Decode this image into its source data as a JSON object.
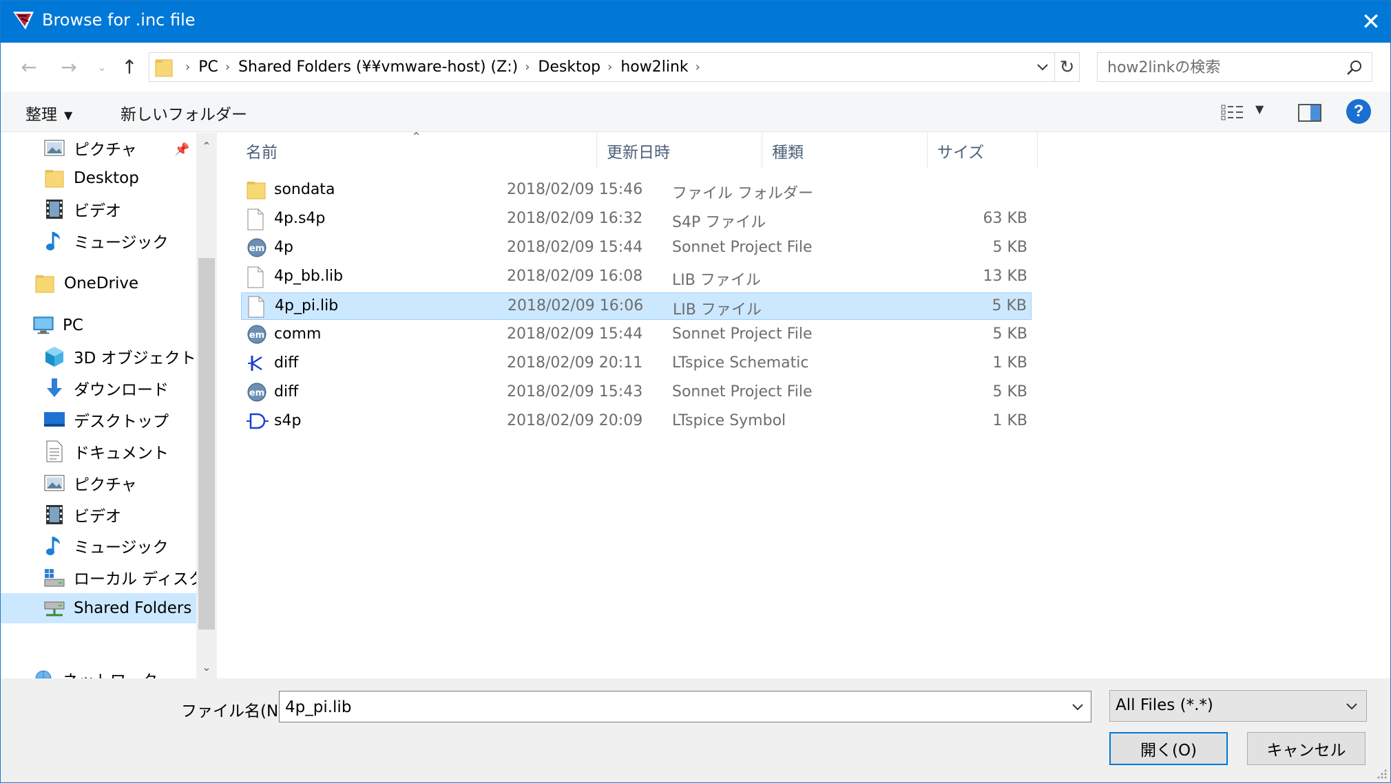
{
  "window": {
    "title": "Browse for .inc file",
    "close_label": "✕"
  },
  "address": {
    "crumbs": [
      "PC",
      "Shared Folders (¥¥vmware-host) (Z:)",
      "Desktop",
      "how2link"
    ],
    "search_placeholder": "how2linkの検索"
  },
  "toolbar": {
    "organize_label": "整理",
    "new_folder_label": "新しいフォルダー",
    "help_label": "?"
  },
  "nav": {
    "items": [
      {
        "label": "ピクチャ",
        "icon": "pictures-icon"
      },
      {
        "label": "Desktop",
        "icon": "folder-icon"
      },
      {
        "label": "ビデオ",
        "icon": "videos-icon"
      },
      {
        "label": "ミュージック",
        "icon": "music-icon"
      },
      {
        "label": "OneDrive",
        "icon": "folder-icon"
      },
      {
        "label": "PC",
        "icon": "computer-icon"
      },
      {
        "label": "3D オブジェクト",
        "icon": "3d-objects-icon"
      },
      {
        "label": "ダウンロード",
        "icon": "downloads-icon"
      },
      {
        "label": "デスクトップ",
        "icon": "desktop-icon"
      },
      {
        "label": "ドキュメント",
        "icon": "documents-icon"
      },
      {
        "label": "ピクチャ",
        "icon": "pictures-icon"
      },
      {
        "label": "ビデオ",
        "icon": "videos-icon"
      },
      {
        "label": "ミュージック",
        "icon": "music-icon"
      },
      {
        "label": "ローカル ディスク (C",
        "icon": "local-disk-icon"
      },
      {
        "label": "Shared Folders (¥",
        "icon": "network-drive-icon"
      },
      {
        "label": "ネットワーク",
        "icon": "network-icon"
      }
    ]
  },
  "columns": {
    "name": "名前",
    "date": "更新日時",
    "type": "種類",
    "size": "サイズ"
  },
  "files": [
    {
      "name": "sondata",
      "date": "2018/02/09 15:46",
      "type": "ファイル フォルダー",
      "size": "",
      "icon": "folder-icon"
    },
    {
      "name": "4p.s4p",
      "date": "2018/02/09 16:32",
      "type": "S4P ファイル",
      "size": "63 KB",
      "icon": "file-icon"
    },
    {
      "name": "4p",
      "date": "2018/02/09 15:44",
      "type": "Sonnet Project File",
      "size": "5 KB",
      "icon": "sonnet-icon"
    },
    {
      "name": "4p_bb.lib",
      "date": "2018/02/09 16:08",
      "type": "LIB ファイル",
      "size": "13 KB",
      "icon": "file-icon"
    },
    {
      "name": "4p_pi.lib",
      "date": "2018/02/09 16:06",
      "type": "LIB ファイル",
      "size": "5 KB",
      "icon": "file-icon",
      "selected": true
    },
    {
      "name": "comm",
      "date": "2018/02/09 15:44",
      "type": "Sonnet Project File",
      "size": "5 KB",
      "icon": "sonnet-icon"
    },
    {
      "name": "diff",
      "date": "2018/02/09 20:11",
      "type": "LTspice Schematic",
      "size": "1 KB",
      "icon": "ltspice-schematic-icon"
    },
    {
      "name": "diff",
      "date": "2018/02/09 15:43",
      "type": "Sonnet Project File",
      "size": "5 KB",
      "icon": "sonnet-icon"
    },
    {
      "name": "s4p",
      "date": "2018/02/09 20:09",
      "type": "LTspice Symbol",
      "size": "1 KB",
      "icon": "ltspice-symbol-icon"
    }
  ],
  "footer": {
    "filename_label": "ファイル名(N):",
    "filename_value": "4p_pi.lib",
    "filter_value": "All Files (*.*)",
    "open_label": "開く(O)",
    "cancel_label": "キャンセル"
  },
  "colors": {
    "titlebar": "#0078d7",
    "selection": "#cce8ff",
    "selection_border": "#99d1ff",
    "folder": "#f8d775"
  }
}
